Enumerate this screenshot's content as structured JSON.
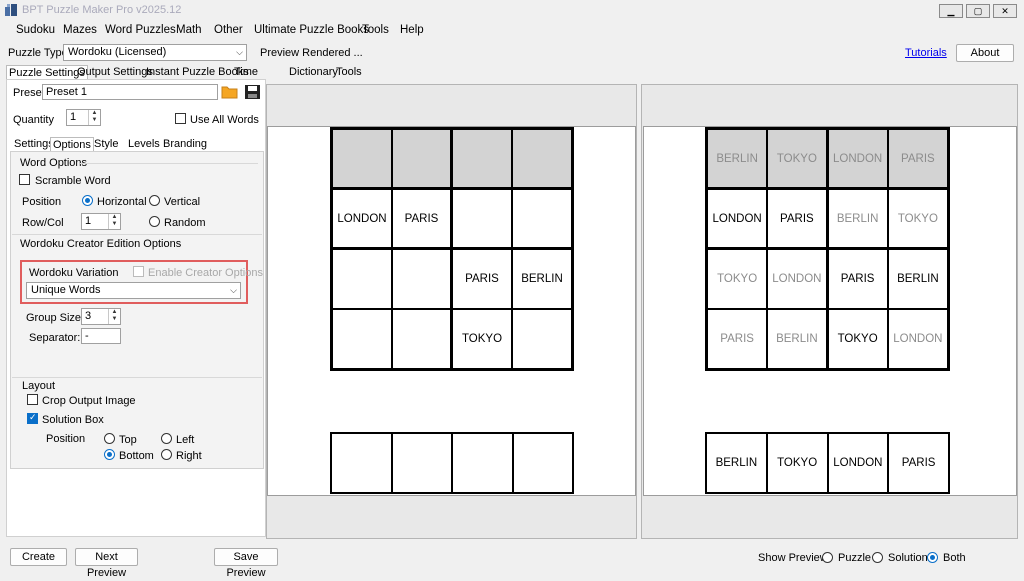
{
  "window": {
    "title": "BPT Puzzle Maker Pro v2025.12",
    "controls": [
      "minimize-icon",
      "maximize-icon",
      "close-icon"
    ]
  },
  "menu": [
    "Sudoku",
    "Mazes",
    "Word Puzzles",
    "Math",
    "Other",
    "Ultimate Puzzle Books",
    "Tools",
    "Help"
  ],
  "toolbar": {
    "puzzle_type_label": "Puzzle Type",
    "puzzle_type_value": "Wordoku (Licensed)",
    "status": "Preview Rendered ...",
    "tutorials_link": "Tutorials",
    "about_button": "About"
  },
  "main_tabs": [
    "Puzzle Settings",
    "Output Settings",
    "Instant Puzzle Books",
    "Time Saver",
    "Dictionary",
    "Tools"
  ],
  "preset": {
    "label": "Preset",
    "value": "Preset 1"
  },
  "quantity": {
    "label": "Quantity",
    "value": "1"
  },
  "use_all_words": "Use All Words",
  "sub_tabs": [
    "Settings",
    "Options",
    "Style",
    "Levels",
    "Branding"
  ],
  "word_options": {
    "title": "Word Options",
    "scramble": "Scramble Word",
    "position_label": "Position",
    "horizontal": "Horizontal",
    "vertical": "Vertical",
    "rowcol_label": "Row/Col",
    "rowcol_value": "1",
    "random": "Random"
  },
  "creator": {
    "title": "Wordoku Creator Edition Options",
    "variation_label": "Wordoku Variation",
    "enable_creator": "Enable Creator Options",
    "variation_value": "Unique Words",
    "group_size_label": "Group Size",
    "group_size_value": "3",
    "separator_label": "Separator:",
    "separator_value": "-"
  },
  "layout": {
    "title": "Layout",
    "crop": "Crop Output Image",
    "solution_box": "Solution Box",
    "position_label": "Position",
    "top": "Top",
    "left": "Left",
    "bottom": "Bottom",
    "right": "Right"
  },
  "bottom": {
    "create": "Create",
    "next_preview": "Next Preview",
    "save_preview": "Save Preview",
    "show_preview_label": "Show Preview:",
    "puzzle": "Puzzle",
    "solution": "Solution",
    "both": "Both"
  },
  "puzzle_grid": [
    [
      "",
      "",
      "",
      ""
    ],
    [
      "LONDON",
      "PARIS",
      "",
      ""
    ],
    [
      "",
      "",
      "PARIS",
      "BERLIN"
    ],
    [
      "",
      "",
      "TOKYO",
      ""
    ]
  ],
  "puzzle_wordbox": [
    "",
    "",
    "",
    ""
  ],
  "solution_grid": [
    [
      "BERLIN",
      "TOKYO",
      "LONDON",
      "PARIS"
    ],
    [
      "LONDON",
      "PARIS",
      "BERLIN",
      "TOKYO"
    ],
    [
      "TOKYO",
      "LONDON",
      "PARIS",
      "BERLIN"
    ],
    [
      "PARIS",
      "BERLIN",
      "TOKYO",
      "LONDON"
    ]
  ],
  "solution_given": [
    [
      false,
      false,
      false,
      false
    ],
    [
      true,
      true,
      false,
      false
    ],
    [
      false,
      false,
      true,
      true
    ],
    [
      false,
      false,
      true,
      false
    ]
  ],
  "solution_wordbox": [
    "BERLIN",
    "TOKYO",
    "LONDON",
    "PARIS"
  ],
  "colors": {
    "accent": "#0a6fc9",
    "highlight": "#e05d5d",
    "header_cell": "#d3d3d3",
    "hint_text": "#8c8c8c"
  }
}
